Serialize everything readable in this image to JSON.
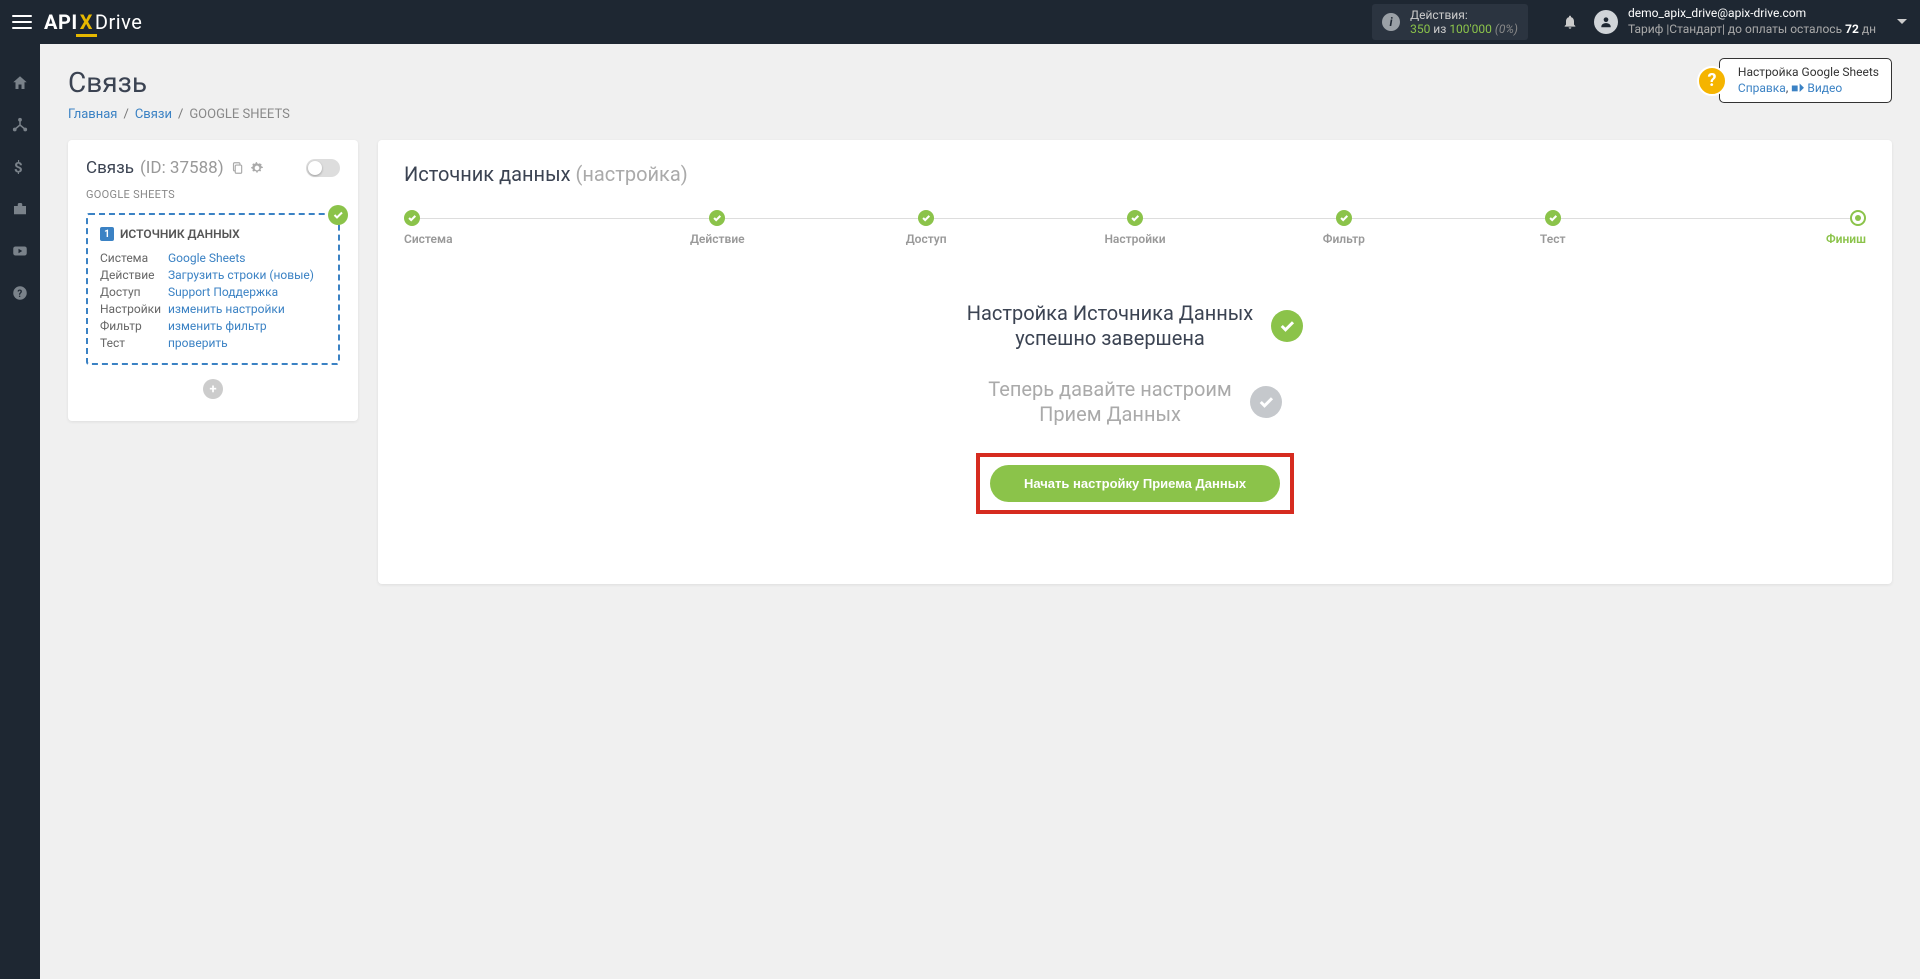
{
  "topbar": {
    "logo": {
      "part1": "API",
      "x": "X",
      "part2": "Drive"
    },
    "actions": {
      "label": "Действия:",
      "used": "350",
      "sep": "из",
      "total": "100'000",
      "pct": "(0%)"
    },
    "user": {
      "email": "demo_apix_drive@apix-drive.com",
      "tariff_prefix": "Тариф |Стандарт| до оплаты осталось ",
      "days": "72",
      "days_suffix": " дн"
    }
  },
  "help": {
    "title": "Настройка Google Sheets",
    "link1": "Справка",
    "link2": "Видео"
  },
  "page": {
    "title": "Связь",
    "breadcrumb": {
      "home": "Главная",
      "links": "Связи",
      "current": "GOOGLE SHEETS"
    }
  },
  "sidecard": {
    "label": "Связь",
    "id": "(ID: 37588)",
    "gs": "GOOGLE SHEETS",
    "src_title": "ИСТОЧНИК ДАННЫХ",
    "rows": [
      {
        "k": "Система",
        "v": "Google Sheets"
      },
      {
        "k": "Действие",
        "v": "Загрузить строки (новые)"
      },
      {
        "k": "Доступ",
        "v": "Support Поддержка"
      },
      {
        "k": "Настройки",
        "v": "изменить настройки"
      },
      {
        "k": "Фильтр",
        "v": "изменить фильтр"
      },
      {
        "k": "Тест",
        "v": "проверить"
      }
    ]
  },
  "main": {
    "title": "Источник данных",
    "subtitle": "(настройка)",
    "steps": [
      "Система",
      "Действие",
      "Доступ",
      "Настройки",
      "Фильтр",
      "Тест",
      "Финиш"
    ],
    "status1_line1": "Настройка Источника Данных",
    "status1_line2": "успешно завершена",
    "status2_line1": "Теперь давайте настроим",
    "status2_line2": "Прием Данных",
    "cta": "Начать настройку Приема Данных"
  }
}
